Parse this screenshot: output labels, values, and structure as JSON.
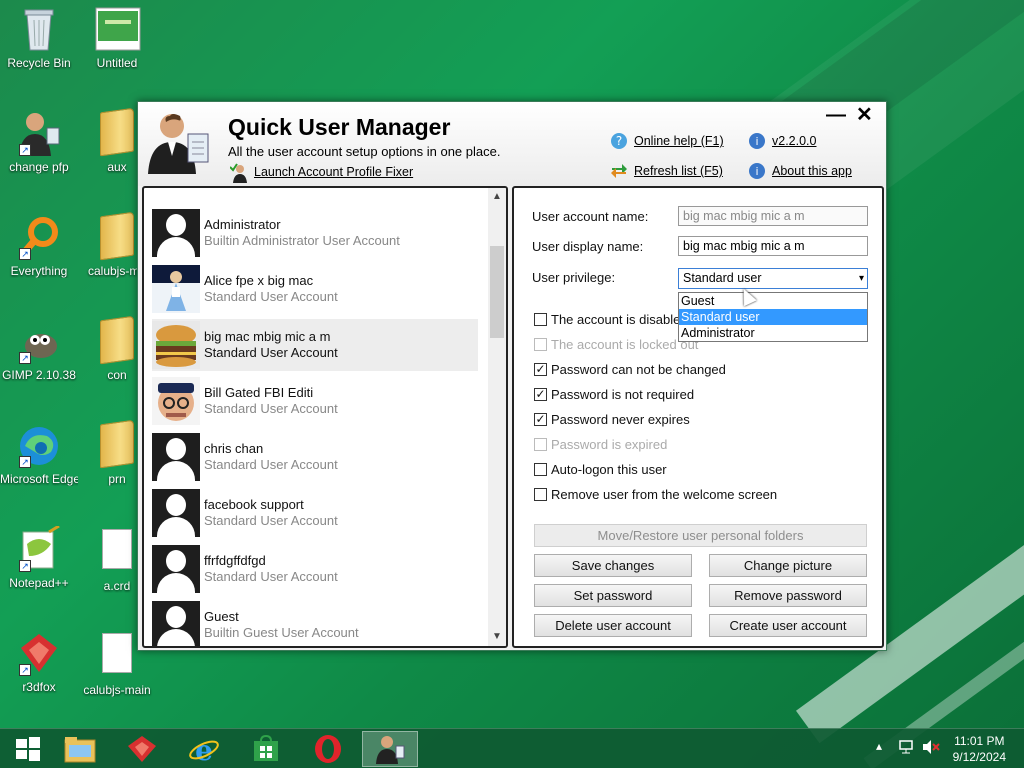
{
  "desktop": {
    "icons": [
      {
        "label": "Recycle Bin"
      },
      {
        "label": "Untitled"
      },
      {
        "label": "change pfp"
      },
      {
        "label": "aux"
      },
      {
        "label": "Everything"
      },
      {
        "label": "calubjs-ma"
      },
      {
        "label": "GIMP 2.10.38"
      },
      {
        "label": "con"
      },
      {
        "label": "Microsoft Edge"
      },
      {
        "label": "prn"
      },
      {
        "label": "Notepad++"
      },
      {
        "label": "a.crd"
      },
      {
        "label": "r3dfox"
      },
      {
        "label": "calubjs-main"
      }
    ]
  },
  "app": {
    "title": "Quick User Manager",
    "subtitle": "All the user account setup options in one place.",
    "fixer_link": "Launch Account Profile Fixer",
    "online_help": "Online help (F1)",
    "version": "v2.2.0.0",
    "refresh": "Refresh list (F5)",
    "about": "About this app",
    "minimize": "—",
    "close": "✕"
  },
  "users": [
    {
      "name": "Administrator",
      "type": "Builtin Administrator User Account"
    },
    {
      "name": "Alice fpe x big mac",
      "type": "Standard User Account"
    },
    {
      "name": "big mac mbig mic a m",
      "type": "Standard User Account"
    },
    {
      "name": "Bill Gated FBI Editi",
      "type": "Standard User Account"
    },
    {
      "name": "chris chan",
      "type": "Standard User Account"
    },
    {
      "name": "facebook support",
      "type": "Standard User Account"
    },
    {
      "name": "ffrfdgffdfgd",
      "type": "Standard User Account"
    },
    {
      "name": "Guest",
      "type": "Builtin Guest User Account"
    }
  ],
  "details": {
    "account_name_label": "User account name:",
    "account_name_value": "big mac mbig mic a m",
    "display_name_label": "User display name:",
    "display_name_value": "big mac mbig mic a m",
    "privilege_label": "User privilege:",
    "privilege_value": "Standard user",
    "privilege_options": [
      "Guest",
      "Standard user",
      "Administrator"
    ],
    "checkboxes": [
      {
        "label": "The account is disabled",
        "checked": false,
        "enabled": true
      },
      {
        "label": "The account is locked out",
        "checked": false,
        "enabled": false
      },
      {
        "label": "Password can not be changed",
        "checked": true,
        "enabled": true
      },
      {
        "label": "Password is not required",
        "checked": true,
        "enabled": true
      },
      {
        "label": "Password never expires",
        "checked": true,
        "enabled": true
      },
      {
        "label": "Password is expired",
        "checked": false,
        "enabled": false
      },
      {
        "label": "Auto-logon this user",
        "checked": false,
        "enabled": true
      },
      {
        "label": "Remove user from the welcome screen",
        "checked": false,
        "enabled": true
      }
    ]
  },
  "buttons": {
    "move_restore": "Move/Restore user personal folders",
    "save": "Save changes",
    "change_picture": "Change picture",
    "set_password": "Set password",
    "remove_password": "Remove password",
    "delete_user": "Delete user account",
    "create_user": "Create user account"
  },
  "taskbar": {
    "time": "11:01 PM",
    "date": "9/12/2024",
    "tray_up": "▴"
  },
  "colors": {
    "accent": "#3399ff",
    "desktop_green": "#139f55"
  }
}
